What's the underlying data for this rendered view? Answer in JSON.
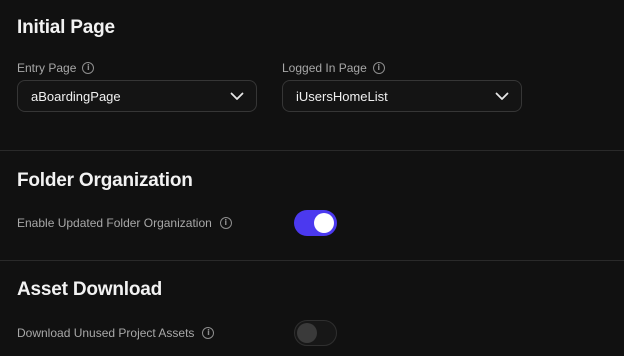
{
  "initial_page": {
    "title": "Initial Page",
    "entry_page": {
      "label": "Entry Page",
      "value": "aBoardingPage"
    },
    "logged_in_page": {
      "label": "Logged In Page",
      "value": "iUsersHomeList"
    }
  },
  "folder_organization": {
    "title": "Folder Organization",
    "toggle_label": "Enable Updated Folder Organization",
    "enabled": true
  },
  "asset_download": {
    "title": "Asset Download",
    "toggle_label": "Download Unused Project Assets",
    "enabled": false
  },
  "colors": {
    "accent": "#4b39ef",
    "background": "#111111"
  }
}
